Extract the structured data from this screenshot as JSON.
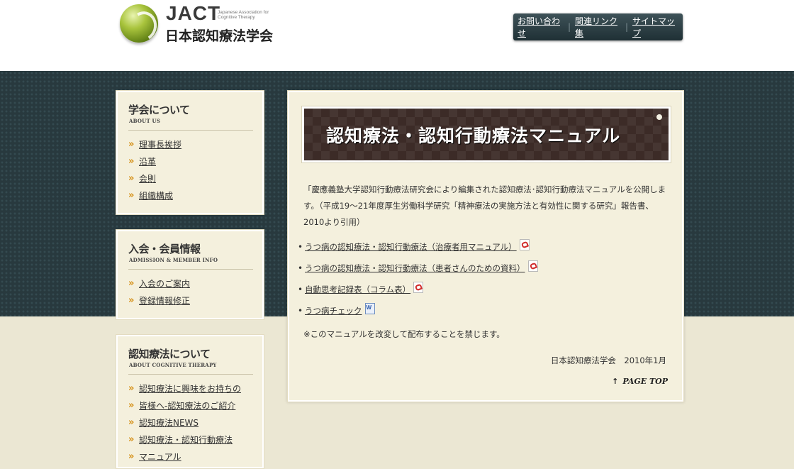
{
  "header": {
    "logo_abbr": "JACT",
    "logo_subtitle": "Japanese Association for Cognitive Therapy",
    "logo_name": "日本認知療法学会",
    "nav": [
      "お問い合わせ",
      "関連リンク集",
      "サイトマップ"
    ]
  },
  "sidebar": [
    {
      "title": "学会について",
      "subtitle": "ABOUT US",
      "items": [
        "理事長挨拶",
        "沿革",
        "会則",
        "組織構成"
      ]
    },
    {
      "title": "入会・会員情報",
      "subtitle": "ADMISSION & MEMBER INFO",
      "items": [
        "入会のご案内",
        "登録情報修正"
      ]
    },
    {
      "title": "認知療法について",
      "subtitle": "ABOUT COGNITIVE THERAPY",
      "items": [
        "認知療法に興味をお持ちの",
        "皆様へ-認知療法のご紹介",
        "認知療法NEWS",
        "認知療法・認知行動療法",
        "マニュアル"
      ]
    }
  ],
  "main": {
    "banner_title": "認知療法・認知行動療法マニュアル",
    "intro": "「慶應義塾大学認知行動療法研究会により編集された認知療法･認知行動療法マニュアルを公開します。（平成19～21年度厚生労働科学研究「精神療法の実施方法と有効性に関する研究」報告書、2010より引用）",
    "documents": [
      {
        "label": "うつ病の認知療法・認知行動療法（治療者用マニュアル）",
        "icon": "pdf-icon"
      },
      {
        "label": "うつ病の認知療法・認知行動療法（患者さんのための資料）",
        "icon": "pdf-icon"
      },
      {
        "label": "自動思考記録表（コラム表）",
        "icon": "pdf-icon"
      },
      {
        "label": "うつ病チェック",
        "icon": "word-doc-icon"
      }
    ],
    "notice": "※このマニュアルを改変して配布することを禁じます。",
    "signature": "日本認知療法学会　2010年1月",
    "page_top": "PAGE TOP"
  }
}
